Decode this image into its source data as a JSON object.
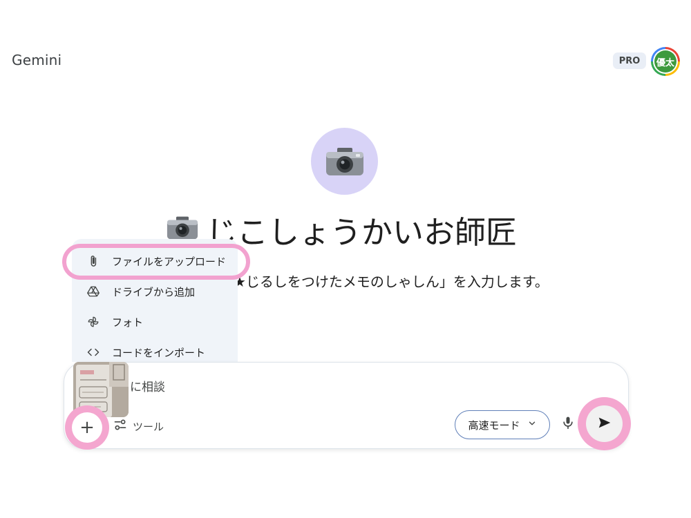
{
  "header": {
    "app_title": "Gemini",
    "plan_badge": "PRO",
    "avatar_text": "優太"
  },
  "gem": {
    "icon": "camera-emoji",
    "name": "じこしょうかいお師匠",
    "description": "★じるしをつけたメモのしゃしん」を入力します。"
  },
  "upload_menu": {
    "items": [
      {
        "label": "ファイルをアップロード",
        "icon": "paperclip-icon"
      },
      {
        "label": "ドライブから追加",
        "icon": "google-drive-icon"
      },
      {
        "label": "フォト",
        "icon": "pinwheel-photos-icon"
      },
      {
        "label": "コードをインポート",
        "icon": "code-brackets-icon"
      }
    ]
  },
  "composer": {
    "placeholder": "に相談",
    "add_label": "+",
    "tools_label": "ツール",
    "mode_label": "高速モード"
  },
  "colors": {
    "highlight": "#f2a2cf",
    "menu_bg": "#f0f4f9",
    "gem_circle": "#d8d3f7",
    "mode_border": "#5f7fb8"
  }
}
